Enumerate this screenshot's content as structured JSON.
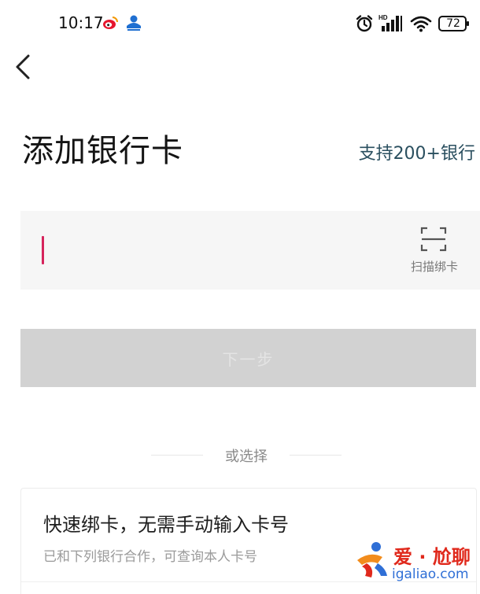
{
  "status_bar": {
    "time": "10:17",
    "battery": "72",
    "icons": [
      "weibo-icon",
      "app-icon",
      "alarm-icon",
      "signal-icon",
      "wifi-icon",
      "battery-icon"
    ]
  },
  "nav": {
    "back_icon": "chevron-left-icon"
  },
  "header": {
    "title": "添加银行卡",
    "supported_banks": "支持200+银行"
  },
  "card_input": {
    "value": "",
    "scan_label": "扫描绑卡",
    "scan_icon": "scan-frame-icon",
    "cursor_color": "#d6245c"
  },
  "next_button": {
    "label": "下一步"
  },
  "divider": {
    "label": "或选择"
  },
  "quick_bind": {
    "title": "快速绑卡，无需手动输入卡号",
    "description": "已和下列银行合作，可查询本人卡号"
  },
  "watermark": {
    "text": "爱 · 尬聊",
    "url": "igaliao.com"
  },
  "colors": {
    "accent_link": "#2a4f5f",
    "button_disabled": "#d2d2d2",
    "input_bg": "#f6f6f6"
  }
}
